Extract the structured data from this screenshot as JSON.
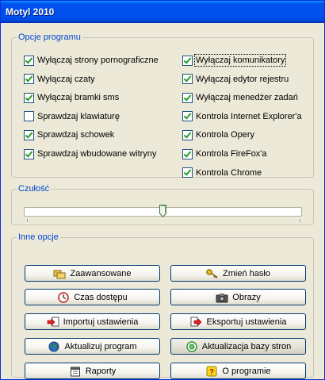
{
  "window": {
    "title": "Motyl 2010"
  },
  "opcje": {
    "legend": "Opcje programu",
    "left": [
      {
        "label": "Wyłączaj strony pornograficzne",
        "checked": true
      },
      {
        "label": "Wyłączaj czaty",
        "checked": true
      },
      {
        "label": "Wyłączaj bramki sms",
        "checked": true
      },
      {
        "label": "Sprawdzaj klawiaturę",
        "checked": false
      },
      {
        "label": "Sprawdzaj schowek",
        "checked": true
      },
      {
        "label": "Sprawdzaj wbudowane witryny",
        "checked": true
      }
    ],
    "right": [
      {
        "label": "Wyłączaj komunikatory",
        "checked": true
      },
      {
        "label": "Wyłączaj edytor rejestru",
        "checked": true
      },
      {
        "label": "Wyłączaj menedżer zadań",
        "checked": true
      },
      {
        "label": "Kontrola Internet Explorer'a",
        "checked": true
      },
      {
        "label": "Kontrola Opery",
        "checked": true
      },
      {
        "label": "Kontrola FireFox'a",
        "checked": true
      },
      {
        "label": "Kontrola Chrome",
        "checked": true
      }
    ]
  },
  "czulosc": {
    "legend": "Czułość",
    "level_fraction": 0.5
  },
  "inne": {
    "legend": "Inne opcje",
    "buttons": {
      "zaawansowane": "Zaawansowane",
      "zmien_haslo": "Zmień hasło",
      "czas_dostepu": "Czas dostępu",
      "obrazy": "Obrazy",
      "importuj": "Importuj ustawienia",
      "eksportuj": "Eksportuj ustawienia",
      "aktualizuj": "Aktualizuj program",
      "aktualizacja_bazy": "Aktualizacja bazy stron",
      "raporty": "Raporty",
      "o_programie": "O programie"
    }
  }
}
